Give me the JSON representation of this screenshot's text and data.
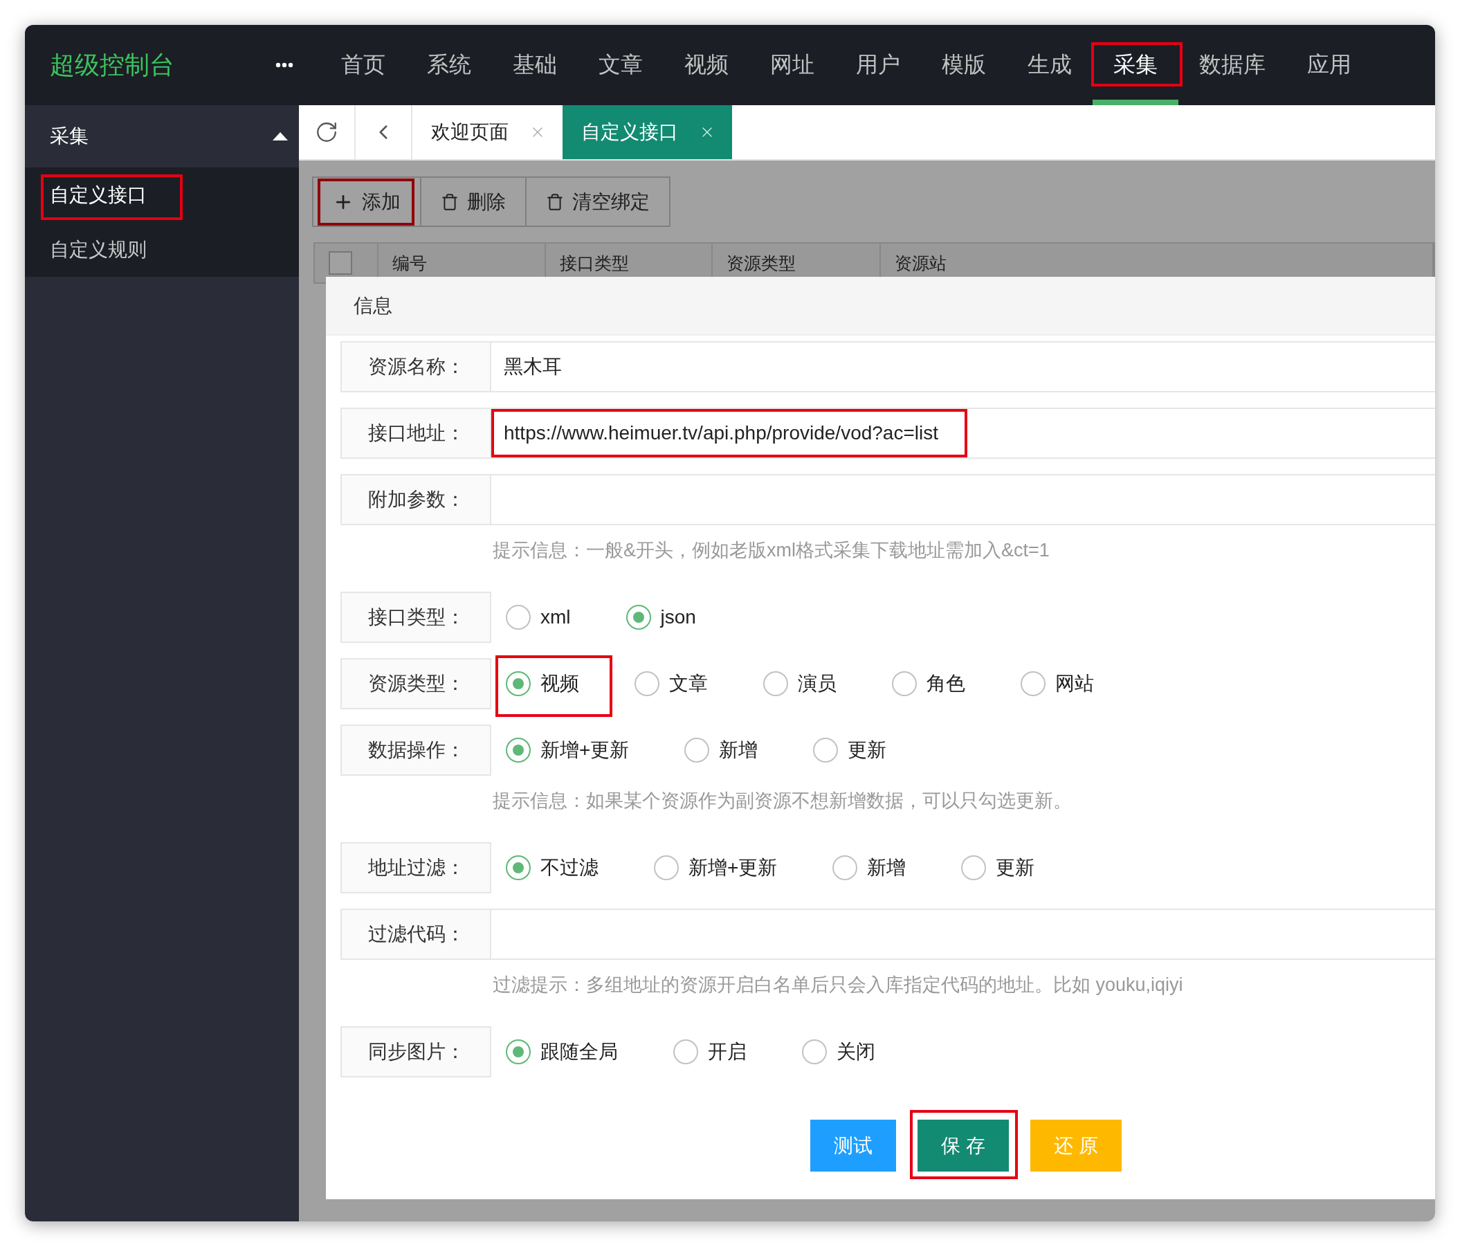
{
  "logo": "超级控制台",
  "nav": [
    {
      "label": "首页",
      "selected": false
    },
    {
      "label": "系统",
      "selected": false
    },
    {
      "label": "基础",
      "selected": false
    },
    {
      "label": "文章",
      "selected": false
    },
    {
      "label": "视频",
      "selected": false
    },
    {
      "label": "网址",
      "selected": false
    },
    {
      "label": "用户",
      "selected": false
    },
    {
      "label": "模版",
      "selected": false
    },
    {
      "label": "生成",
      "selected": false
    },
    {
      "label": "采集",
      "selected": true,
      "highlighted": true
    },
    {
      "label": "数据库",
      "selected": false
    },
    {
      "label": "应用",
      "selected": false
    }
  ],
  "sidebar": {
    "title": "采集",
    "expanded": true,
    "items": [
      {
        "label": "自定义接口",
        "selected": true,
        "highlighted": true
      },
      {
        "label": "自定义规则",
        "selected": false
      }
    ]
  },
  "tabs": [
    {
      "label": "欢迎页面",
      "selected": false
    },
    {
      "label": "自定义接口",
      "selected": true
    }
  ],
  "toolbar": [
    {
      "label": "添加",
      "kind": "plus",
      "highlighted": true
    },
    {
      "label": "删除",
      "kind": "trash"
    },
    {
      "label": "清空绑定",
      "kind": "trash"
    }
  ],
  "table": {
    "select_all_checked": false,
    "columns": [
      "编号",
      "接口类型",
      "资源类型",
      "资源站"
    ]
  },
  "dialog": {
    "title": "信息",
    "fields": [
      {
        "kind": "text",
        "label": "资源名称：",
        "value": "黑木耳"
      },
      {
        "kind": "text",
        "label": "接口地址：",
        "value": "https://www.heimuer.tv/api.php/provide/vod?ac=list",
        "highlighted": true
      },
      {
        "kind": "text",
        "label": "附加参数："
      },
      {
        "kind": "hint",
        "text": "提示信息：一般&开头，例如老版xml格式采集下载地址需加入&ct=1"
      },
      {
        "kind": "radio",
        "label": "接口类型：",
        "options": [
          {
            "label": "xml",
            "selected": false
          },
          {
            "label": "json",
            "selected": true
          }
        ]
      },
      {
        "kind": "radio",
        "label": "资源类型：",
        "options": [
          {
            "label": "视频",
            "selected": true,
            "highlighted": true
          },
          {
            "label": "文章",
            "selected": false
          },
          {
            "label": "演员",
            "selected": false
          },
          {
            "label": "角色",
            "selected": false
          },
          {
            "label": "网站",
            "selected": false
          }
        ]
      },
      {
        "kind": "radio",
        "label": "数据操作：",
        "options": [
          {
            "label": "新增+更新",
            "selected": true
          },
          {
            "label": "新增",
            "selected": false
          },
          {
            "label": "更新",
            "selected": false
          }
        ]
      },
      {
        "kind": "hint",
        "text": "提示信息：如果某个资源作为副资源不想新增数据，可以只勾选更新。"
      },
      {
        "kind": "radio",
        "label": "地址过滤：",
        "options": [
          {
            "label": "不过滤",
            "selected": true
          },
          {
            "label": "新增+更新",
            "selected": false
          },
          {
            "label": "新增",
            "selected": false
          },
          {
            "label": "更新",
            "selected": false
          }
        ]
      },
      {
        "kind": "text",
        "label": "过滤代码："
      },
      {
        "kind": "hint",
        "text": "过滤提示：多组地址的资源开启白名单后只会入库指定代码的地址。比如 youku,iqiyi"
      },
      {
        "kind": "radio",
        "label": "同步图片：",
        "options": [
          {
            "label": "跟随全局",
            "selected": true
          },
          {
            "label": "开启",
            "selected": false
          },
          {
            "label": "关闭",
            "selected": false
          }
        ]
      }
    ],
    "buttons": [
      {
        "label": "测试",
        "color": "#1e9fff"
      },
      {
        "label": "保 存",
        "color": "#138a72",
        "highlighted": true
      },
      {
        "label": "还 原",
        "color": "#ffb800"
      }
    ]
  }
}
